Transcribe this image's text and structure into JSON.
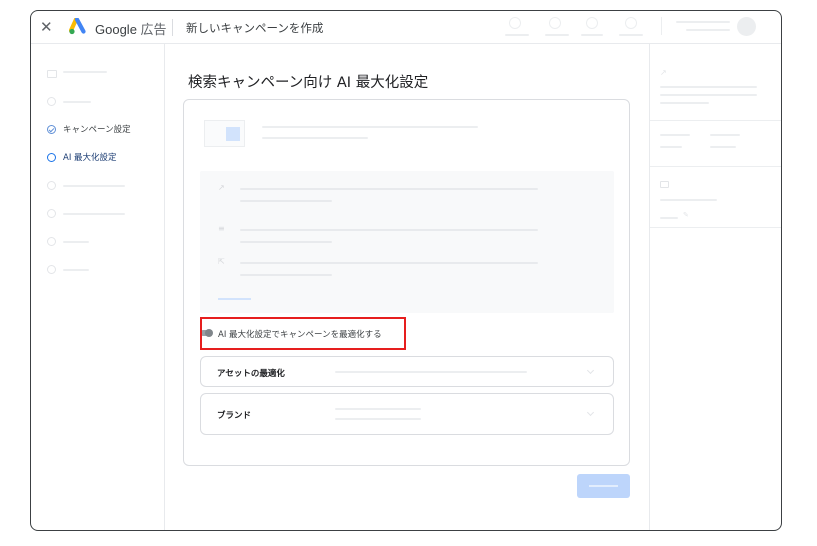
{
  "header": {
    "close_glyph": "✕",
    "brand_google": "Google",
    "brand_ads": "広告",
    "page_title": "新しいキャンペーンを作成"
  },
  "nav": {
    "items": [
      {
        "label": "キャンペーン設定",
        "state": "done"
      },
      {
        "label": "AI 最大化設定",
        "state": "active"
      }
    ]
  },
  "main": {
    "title": "検索キャンペーン向け AI 最大化設定",
    "toggle_label": "AI 最大化設定でキャンペーンを最適化する",
    "accordion": [
      {
        "title": "アセットの最適化"
      },
      {
        "title": "ブランド"
      }
    ]
  },
  "colors": {
    "accent": "#1a73e8",
    "highlight": "#e61e1e",
    "next_button": "#a8c7fa"
  }
}
